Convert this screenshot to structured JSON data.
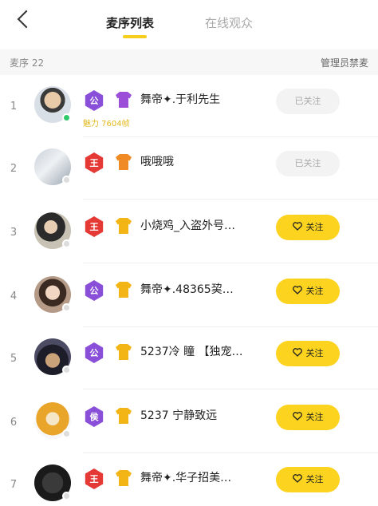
{
  "header": {
    "tabs": [
      {
        "label": "麦序列表",
        "active": true
      },
      {
        "label": "在线观众",
        "active": false
      }
    ]
  },
  "subbar": {
    "count_label": "麦序 22",
    "admin_ban_label": "管理员禁麦"
  },
  "rows": [
    {
      "index": "1",
      "nickname": "舞帝✦.于利先生",
      "charm": "魅力 7604帧",
      "role": "公",
      "role_color": "#8a4fd8",
      "vip_color": "#9b4fd8",
      "follow_label": "已关注",
      "followed": true,
      "online": true
    },
    {
      "index": "2",
      "nickname": "哦哦哦",
      "charm": "",
      "role": "王",
      "role_color": "#e53935",
      "vip_color": "#f08a24",
      "follow_label": "已关注",
      "followed": true,
      "online": false
    },
    {
      "index": "3",
      "nickname": "小烧鸡_入盗外号…",
      "charm": "",
      "role": "王",
      "role_color": "#e53935",
      "vip_color": "#f2b515",
      "follow_label": "关注",
      "followed": false,
      "online": false
    },
    {
      "index": "4",
      "nickname": "舞帝✦.48365巭…",
      "charm": "",
      "role": "公",
      "role_color": "#8a4fd8",
      "vip_color": "#f2b515",
      "follow_label": "关注",
      "followed": false,
      "online": false
    },
    {
      "index": "5",
      "nickname": "5237冷 瞳 【独宠…",
      "charm": "",
      "role": "公",
      "role_color": "#8a4fd8",
      "vip_color": "#f2b515",
      "follow_label": "关注",
      "followed": false,
      "online": false
    },
    {
      "index": "6",
      "nickname": "5237 宁静致远",
      "charm": "",
      "role": "侯",
      "role_color": "#8a4fd8",
      "vip_color": "#f2b515",
      "follow_label": "关注",
      "followed": false,
      "online": false
    },
    {
      "index": "7",
      "nickname": "舞帝✦.华子招美…",
      "charm": "",
      "role": "王",
      "role_color": "#e53935",
      "vip_color": "#f2b515",
      "follow_label": "关注",
      "followed": false,
      "online": false
    }
  ]
}
